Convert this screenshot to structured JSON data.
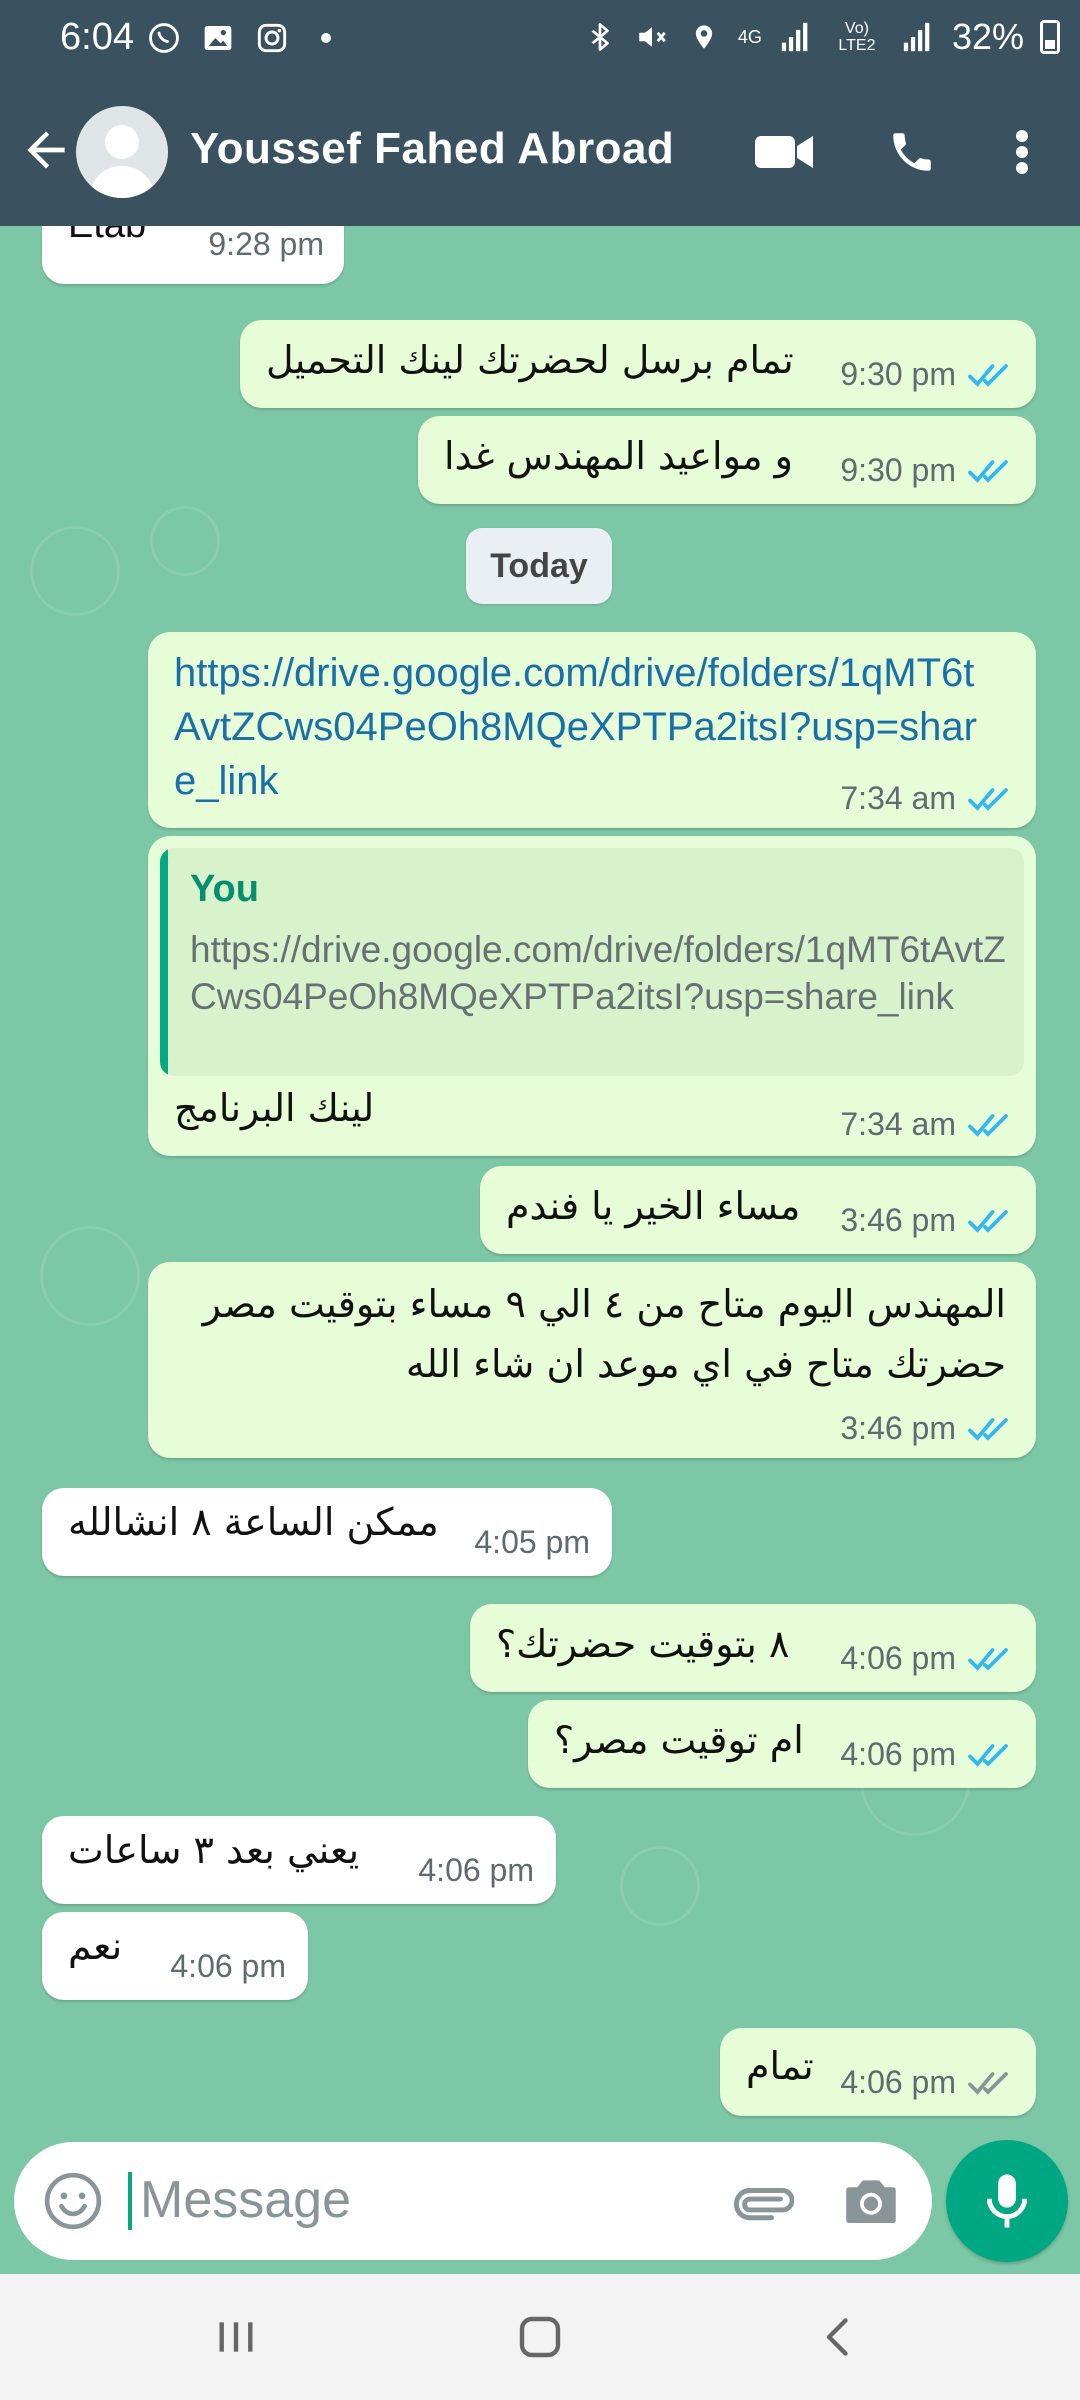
{
  "status_bar": {
    "time": "6:04",
    "network": "4G",
    "volte": "Vo) LTE2",
    "battery": "32%",
    "icons": [
      "whatsapp-icon",
      "gallery-icon",
      "instagram-icon",
      "dot-icon",
      "bluetooth-icon",
      "mute-icon",
      "location-icon",
      "signal-icon",
      "battery-icon"
    ]
  },
  "header": {
    "contact_name": "Youssef Fahed Abroad",
    "icons": [
      "back-arrow-icon",
      "avatar",
      "video-call-icon",
      "voice-call-icon",
      "more-vert-icon"
    ]
  },
  "date_separator": "Today",
  "messages": [
    {
      "direction": "in",
      "text": "Etab",
      "time": "9:28 pm"
    },
    {
      "direction": "out",
      "text": "تمام برسل لحضرتك لينك التحميل",
      "time": "9:30 pm",
      "status": "read"
    },
    {
      "direction": "out",
      "text": "و مواعيد المهندس غدا",
      "time": "9:30 pm",
      "status": "read"
    },
    {
      "direction": "out",
      "type": "link",
      "text": "https://drive.google.com/drive/folders/1qMT6tAvtZCws04PeOh8MQeXPTPa2itsI?usp=share_link",
      "time": "7:34 am",
      "status": "read"
    },
    {
      "direction": "out",
      "type": "reply",
      "quote_author": "You",
      "quote_text": "https://drive.google.com/drive/folders/1qMT6tAvtZCws04PeOh8MQeXPTPa2itsI?usp=share_link",
      "text": "لينك البرنامج",
      "time": "7:34 am",
      "status": "read"
    },
    {
      "direction": "out",
      "text": "مساء الخير يا فندم",
      "time": "3:46 pm",
      "status": "read"
    },
    {
      "direction": "out",
      "text_line1": "المهندس اليوم متاح من ٤ الي ٩ مساء بتوقيت مصر",
      "text_line2": "حضرتك متاح في اي موعد ان شاء الله",
      "time": "3:46 pm",
      "status": "read"
    },
    {
      "direction": "in",
      "text": "ممكن الساعة ٨ انشالله",
      "time": "4:05 pm"
    },
    {
      "direction": "out",
      "text": "٨ بتوقيت حضرتك؟",
      "time": "4:06 pm",
      "status": "read"
    },
    {
      "direction": "out",
      "text": "ام توقيت مصر؟",
      "time": "4:06 pm",
      "status": "read"
    },
    {
      "direction": "in",
      "text": "يعني بعد ٣ ساعات",
      "time": "4:06 pm"
    },
    {
      "direction": "in",
      "text": "نعم",
      "time": "4:06 pm"
    },
    {
      "direction": "out",
      "text": "تمام",
      "time": "4:06 pm",
      "status": "delivered"
    }
  ],
  "input": {
    "placeholder": "Message",
    "icons": [
      "emoji-icon",
      "attach-icon",
      "camera-icon",
      "mic-icon"
    ]
  },
  "colors": {
    "header": "#3a525f",
    "chat_bg": "#7cc7a5",
    "outgoing_bubble": "#e6fdd8",
    "incoming_bubble": "#ffffff",
    "accent": "#00a783",
    "read_tick": "#34b7f1",
    "link": "#1b6fa8"
  },
  "nav_bar": {
    "icons": [
      "recent-apps-icon",
      "home-icon",
      "back-icon"
    ]
  }
}
